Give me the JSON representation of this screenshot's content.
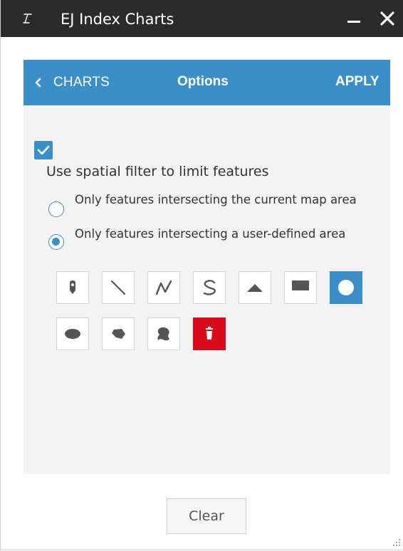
{
  "window": {
    "title": "EJ Index Charts",
    "icon": "widget-app-icon"
  },
  "header": {
    "back_label": "CHARTS",
    "title": "Options",
    "apply_label": "APPLY"
  },
  "spatial_filter": {
    "checked": true,
    "label": "Use spatial filter to limit features",
    "options": [
      {
        "label": "Only features intersecting the current map area",
        "selected": false
      },
      {
        "label": "Only features intersecting a user-defined area",
        "selected": true
      }
    ]
  },
  "draw_tools": [
    {
      "name": "point-tool",
      "icon": "map-pin-icon",
      "state": "normal"
    },
    {
      "name": "line-tool",
      "icon": "line-icon",
      "state": "normal"
    },
    {
      "name": "polyline-tool",
      "icon": "polyline-icon",
      "state": "normal"
    },
    {
      "name": "freehand-polyline-tool",
      "icon": "freehand-line-icon",
      "state": "normal"
    },
    {
      "name": "triangle-tool",
      "icon": "triangle-icon",
      "state": "normal"
    },
    {
      "name": "rectangle-tool",
      "icon": "rectangle-icon",
      "state": "normal"
    },
    {
      "name": "circle-tool",
      "icon": "circle-icon",
      "state": "active"
    },
    {
      "name": "ellipse-tool",
      "icon": "ellipse-icon",
      "state": "normal"
    },
    {
      "name": "polygon-tool",
      "icon": "polygon-icon",
      "state": "normal"
    },
    {
      "name": "freehand-polygon-tool",
      "icon": "freehand-polygon-icon",
      "state": "normal"
    },
    {
      "name": "delete-tool",
      "icon": "trash-icon",
      "state": "danger"
    }
  ],
  "footer": {
    "clear_label": "Clear"
  },
  "colors": {
    "title_bar": "#2b2b2b",
    "accent": "#3a8fc9",
    "panel_bg": "#f3f3f3",
    "danger": "#d80c1b",
    "icon_gray": "#555555"
  }
}
